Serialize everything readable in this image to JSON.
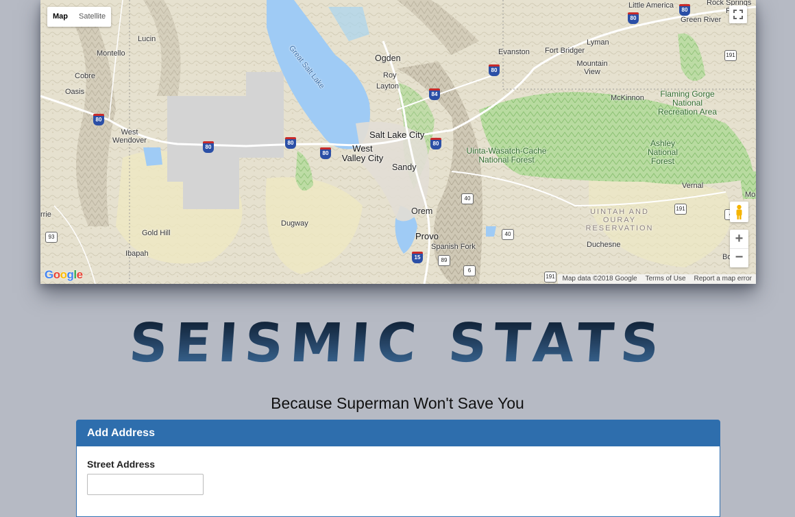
{
  "map": {
    "type_controls": {
      "map_label": "Map",
      "satellite_label": "Satellite"
    },
    "cities": [
      "Little America",
      "Green River",
      "Lucin",
      "Montello",
      "Cobre",
      "Oasis",
      "West Wendover",
      "Ogden",
      "Roy",
      "Layton",
      "Evanston",
      "Fort Bridger",
      "Lyman",
      "Mountain View",
      "McKinnon",
      "Salt Lake City",
      "West Valley City",
      "Sandy",
      "Orem",
      "Provo",
      "Spanish Fork",
      "Dugway",
      "Gold Hill",
      "Ibapah",
      "Duchesne",
      "Vernal",
      "Rock Springs",
      "Pu",
      "rrie",
      "Bo",
      "Mo"
    ],
    "lake_label": "Great Salt Lake",
    "parks": {
      "uinta_wasatch": "Uinta-Wasatch-Cache National Forest",
      "ashley": "Ashley National Forest",
      "flaming_gorge": "Flaming Gorge National Recreation Area",
      "uintah_reservation": "UINTAH AND OURAY RESERVATION"
    },
    "interstate_shields": [
      "80",
      "80",
      "80",
      "80",
      "80",
      "80",
      "80",
      "84",
      "15",
      "80"
    ],
    "us_highway_shields": [
      "191",
      "40",
      "40",
      "89",
      "6",
      "191",
      "93",
      "191",
      "4"
    ],
    "attribution": {
      "map_data": "Map data ©2018 Google",
      "terms": "Terms of Use",
      "report": "Report a map error"
    },
    "logo": "Google",
    "zoom_in": "+",
    "zoom_out": "−"
  },
  "header": {
    "title": "SEISMIC STATS",
    "subtitle": "Because Superman Won't Save You"
  },
  "panel": {
    "heading": "Add Address",
    "street_label": "Street Address",
    "street_value": "",
    "street_placeholder": ""
  },
  "colors": {
    "page_bg": "#b6bac4",
    "panel_header": "#2e6ead",
    "title_dark": "#0f1f33",
    "title_light": "#3e6d9c"
  }
}
